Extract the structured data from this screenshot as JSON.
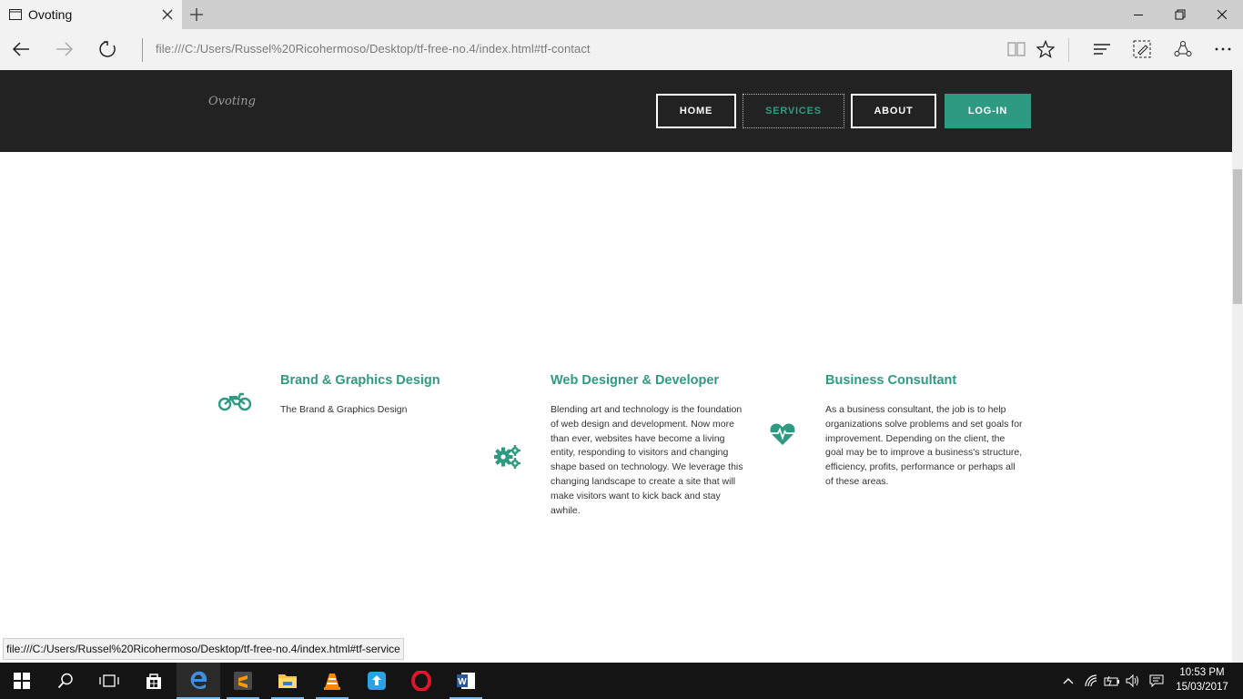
{
  "browser": {
    "tab_title": "Ovoting",
    "url": "file:///C:/Users/Russel%20Ricohermoso/Desktop/tf-free-no.4/index.html#tf-contact",
    "status_url": "file:///C:/Users/Russel%20Ricohermoso/Desktop/tf-free-no.4/index.html#tf-service"
  },
  "site": {
    "logo": "Ovoting",
    "nav": {
      "home": "HOME",
      "services": "SERVICES",
      "about": "ABOUT",
      "login": "LOG-IN"
    }
  },
  "services": [
    {
      "title": "Brand & Graphics Design",
      "text": "The Brand & Graphics Design",
      "icon": "motorcycle-icon"
    },
    {
      "title": "Web Designer & Developer",
      "text": "Blending art and technology is the foundation of web design and development. Now more than ever, websites have become a living entity, responding to visitors and changing shape based on technology. We leverage this changing landscape to create a site that will make visitors want to kick back and stay awhile.",
      "icon": "gears-icon"
    },
    {
      "title": "Business Consultant",
      "text": "As a business consultant, the job is to help organizations solve problems and set goals for improvement. Depending on the client, the goal may be to improve a business's structure, efficiency, profits, performance or perhaps all of these areas.",
      "icon": "heartbeat-icon"
    }
  ],
  "taskbar": {
    "time": "10:53 PM",
    "date": "15/03/2017"
  },
  "colors": {
    "accent": "#2f9a82",
    "header_bg": "#222222"
  }
}
